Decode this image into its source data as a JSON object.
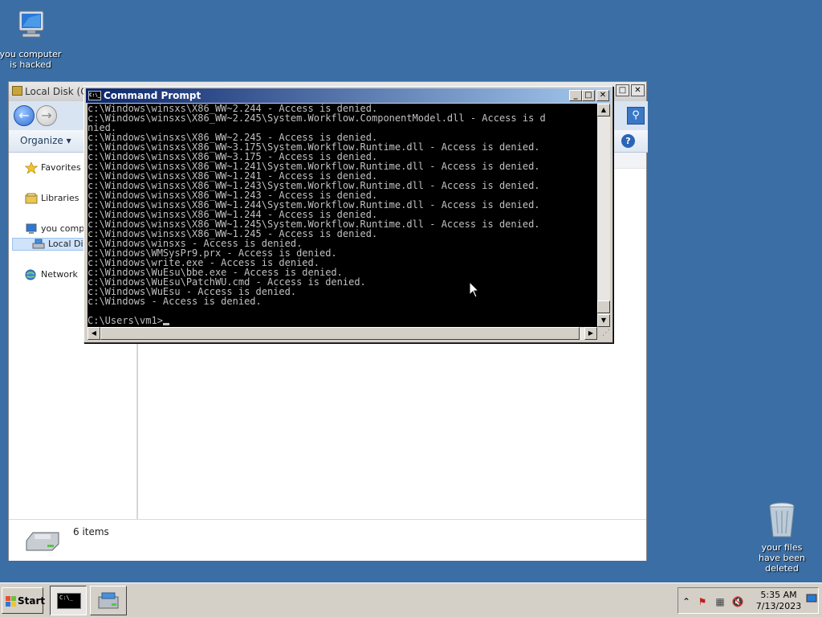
{
  "desktop": {
    "icons": [
      {
        "label": "you computer is hacked"
      },
      {
        "label": "your files have been deleted"
      }
    ]
  },
  "explorer": {
    "title": "Local Disk (C",
    "toolbar": {
      "organize": "Organize"
    },
    "nav": {
      "favorites": "Favorites",
      "libraries": "Libraries",
      "computer": "you compu",
      "local_disk": "Local Dis",
      "network": "Network"
    },
    "status": {
      "count": "6 items"
    }
  },
  "cmd": {
    "title": "Command Prompt",
    "icon_text": "C:\\_",
    "lines": [
      "c:\\Windows\\winsxs\\X86_WW~2.244 - Access is denied.",
      "c:\\Windows\\winsxs\\X86_WW~2.245\\System.Workflow.ComponentModel.dll - Access is d",
      "nied.",
      "c:\\Windows\\winsxs\\X86_WW~2.245 - Access is denied.",
      "c:\\Windows\\winsxs\\X86_WW~3.175\\System.Workflow.Runtime.dll - Access is denied.",
      "c:\\Windows\\winsxs\\X86_WW~3.175 - Access is denied.",
      "c:\\Windows\\winsxs\\X86_WW~1.241\\System.Workflow.Runtime.dll - Access is denied.",
      "c:\\Windows\\winsxs\\X86_WW~1.241 - Access is denied.",
      "c:\\Windows\\winsxs\\X86_WW~1.243\\System.Workflow.Runtime.dll - Access is denied.",
      "c:\\Windows\\winsxs\\X86_WW~1.243 - Access is denied.",
      "c:\\Windows\\winsxs\\X86_WW~1.244\\System.Workflow.Runtime.dll - Access is denied.",
      "c:\\Windows\\winsxs\\X86_WW~1.244 - Access is denied.",
      "c:\\Windows\\winsxs\\X86_WW~1.245\\System.Workflow.Runtime.dll - Access is denied.",
      "c:\\Windows\\winsxs\\X86_WW~1.245 - Access is denied.",
      "c:\\Windows\\winsxs - Access is denied.",
      "c:\\Windows\\WMSysPr9.prx - Access is denied.",
      "c:\\Windows\\write.exe - Access is denied.",
      "c:\\Windows\\WuEsu\\bbe.exe - Access is denied.",
      "c:\\Windows\\WuEsu\\PatchWU.cmd - Access is denied.",
      "c:\\Windows\\WuEsu - Access is denied.",
      "c:\\Windows - Access is denied.",
      ""
    ],
    "prompt": "C:\\Users\\vm1>"
  },
  "taskbar": {
    "start": "Start",
    "cmd_icon_text": "C:\\_",
    "time": "5:35 AM",
    "date": "7/13/2023"
  },
  "colors": {
    "desktop": "#3a6ea5",
    "console_bg": "#000000",
    "console_fg": "#c0c0c0",
    "title_active": "#0a246a"
  }
}
